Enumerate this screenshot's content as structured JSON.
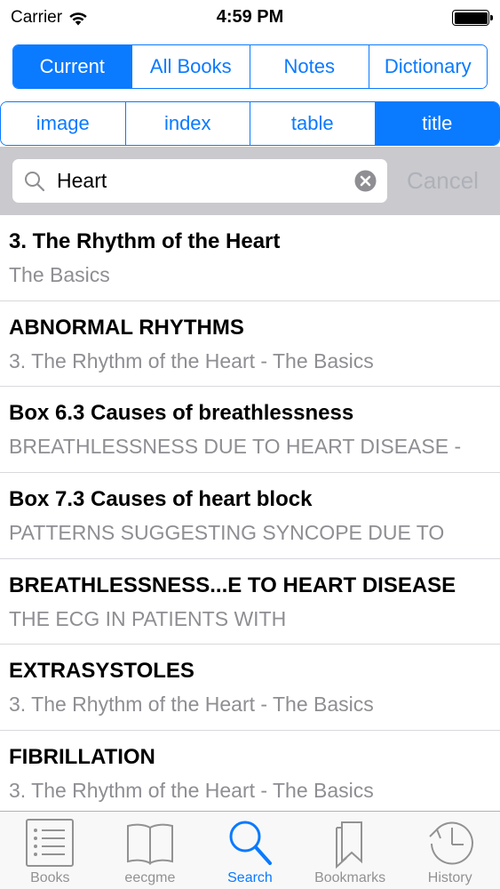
{
  "status_bar": {
    "carrier": "Carrier",
    "time": "4:59 PM"
  },
  "scope_tabs": [
    {
      "label": "Current",
      "active": true
    },
    {
      "label": "All Books",
      "active": false
    },
    {
      "label": "Notes",
      "active": false
    },
    {
      "label": "Dictionary",
      "active": false
    }
  ],
  "filter_tabs": [
    {
      "label": "image",
      "active": false
    },
    {
      "label": "index",
      "active": false
    },
    {
      "label": "table",
      "active": false
    },
    {
      "label": "title",
      "active": true
    }
  ],
  "search": {
    "value": "Heart",
    "cancel_label": "Cancel"
  },
  "results": [
    {
      "title": "3. The Rhythm of the Heart",
      "subtitle": "The Basics"
    },
    {
      "title": "ABNORMAL RHYTHMS",
      "subtitle": "3. The Rhythm of the Heart - The Basics"
    },
    {
      "title": "Box 6.3 Causes of breathlessness",
      "subtitle": "BREATHLESSNESS DUE TO HEART DISEASE -"
    },
    {
      "title": "Box 7.3 Causes of heart block",
      "subtitle": "PATTERNS SUGGESTING SYNCOPE DUE TO"
    },
    {
      "title": "BREATHLESSNESS...E TO HEART DISEASE",
      "subtitle": "THE ECG IN PATIENTS WITH"
    },
    {
      "title": "EXTRASYSTOLES",
      "subtitle": "3. The Rhythm of the Heart - The Basics"
    },
    {
      "title": "FIBRILLATION",
      "subtitle": "3. The Rhythm of the Heart - The Basics"
    }
  ],
  "tabbar": [
    {
      "label": "Books",
      "icon": "list-icon",
      "active": false
    },
    {
      "label": "eecgme",
      "icon": "book-icon",
      "active": false
    },
    {
      "label": "Search",
      "icon": "search-icon",
      "active": true
    },
    {
      "label": "Bookmarks",
      "icon": "bookmarks-icon",
      "active": false
    },
    {
      "label": "History",
      "icon": "clock-icon",
      "active": false
    }
  ],
  "colors": {
    "accent": "#0a7aff",
    "search_bg": "#c9c9ce",
    "secondary_text": "#8e8e93"
  }
}
